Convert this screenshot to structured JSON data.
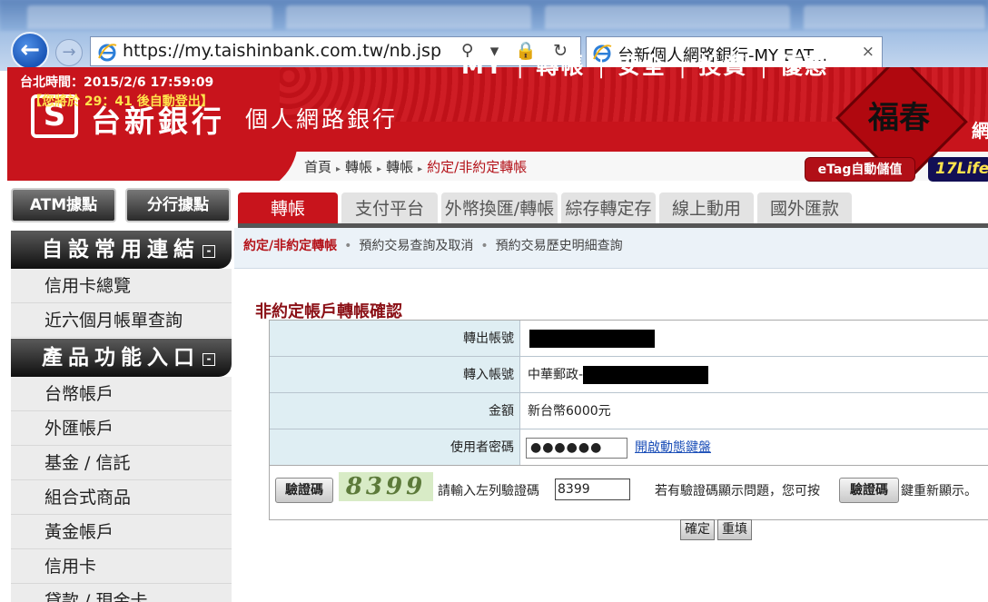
{
  "browser": {
    "url": "https://my.taishinbank.com.tw/nb.jsp",
    "tab_title": "台新個人網路銀行-MY EAT...",
    "tab_close": "×",
    "back_icon": "back-arrow-icon",
    "forward_icon": "forward-arrow-icon",
    "addr_icons": "⚲ ▾ 🔒 ↻"
  },
  "header": {
    "logo_mark": "S",
    "bank_name": "台新銀行",
    "bank_sub": "個人網路銀行",
    "clock": "台北時間：2015/2/6 17:59:09",
    "logout": "【您將於 29：41 後自動登出】",
    "topnav": [
      "MY",
      "轉帳",
      "安全",
      "投資",
      "優惠"
    ],
    "topnav_sep": "|",
    "fuchun": "福春",
    "net_cut": "網",
    "breadcrumb": [
      "首頁",
      "轉帳",
      "轉帳",
      "約定/非約定轉帳"
    ],
    "breadcrumb_arrow": "▸",
    "etag": "eTag自動儲值",
    "life17": "17Life"
  },
  "sidebar": {
    "atm_label": "ATM據點",
    "branch_label": "分行據點",
    "section1_title": "自設常用連結",
    "section1_items": [
      "信用卡總覽",
      "近六個月帳單查詢"
    ],
    "section2_title": "產品功能入口",
    "section2_items": [
      "台幣帳戶",
      "外匯帳戶",
      "基金 / 信託",
      "組合式商品",
      "黃金帳戶",
      "信用卡",
      "貸款 / 現金卡"
    ],
    "collapse_symbol": "-"
  },
  "main": {
    "tabs": [
      "轉帳",
      "支付平台",
      "外幣換匯/轉帳",
      "綜存轉定存",
      "線上動用",
      "國外匯款"
    ],
    "subnav_active": "約定/非約定轉帳",
    "subnav": [
      "預約交易查詢及取消",
      "預約交易歷史明細查詢"
    ],
    "subnav_dot": "•",
    "form_title": "非約定帳戶轉帳確認",
    "rows": {
      "from_label": "轉出帳號",
      "to_label": "轉入帳號",
      "to_value": "中華郵政-",
      "amount_label": "金額",
      "amount_value": "新台幣6000元",
      "pwd_label": "使用者密碼",
      "pwd_value": "●●●●●●",
      "dyn_kb": "開啟動態鍵盤"
    },
    "captcha": {
      "button": "驗證碼",
      "image_text": "8399",
      "prompt": "請輸入左列驗證碼",
      "input_value": "8399",
      "hint": "若有驗證碼顯示問題，您可按",
      "button2": "驗證碼",
      "hint2": "鍵重新顯示。"
    },
    "confirm": "確定",
    "reset": "重填"
  }
}
